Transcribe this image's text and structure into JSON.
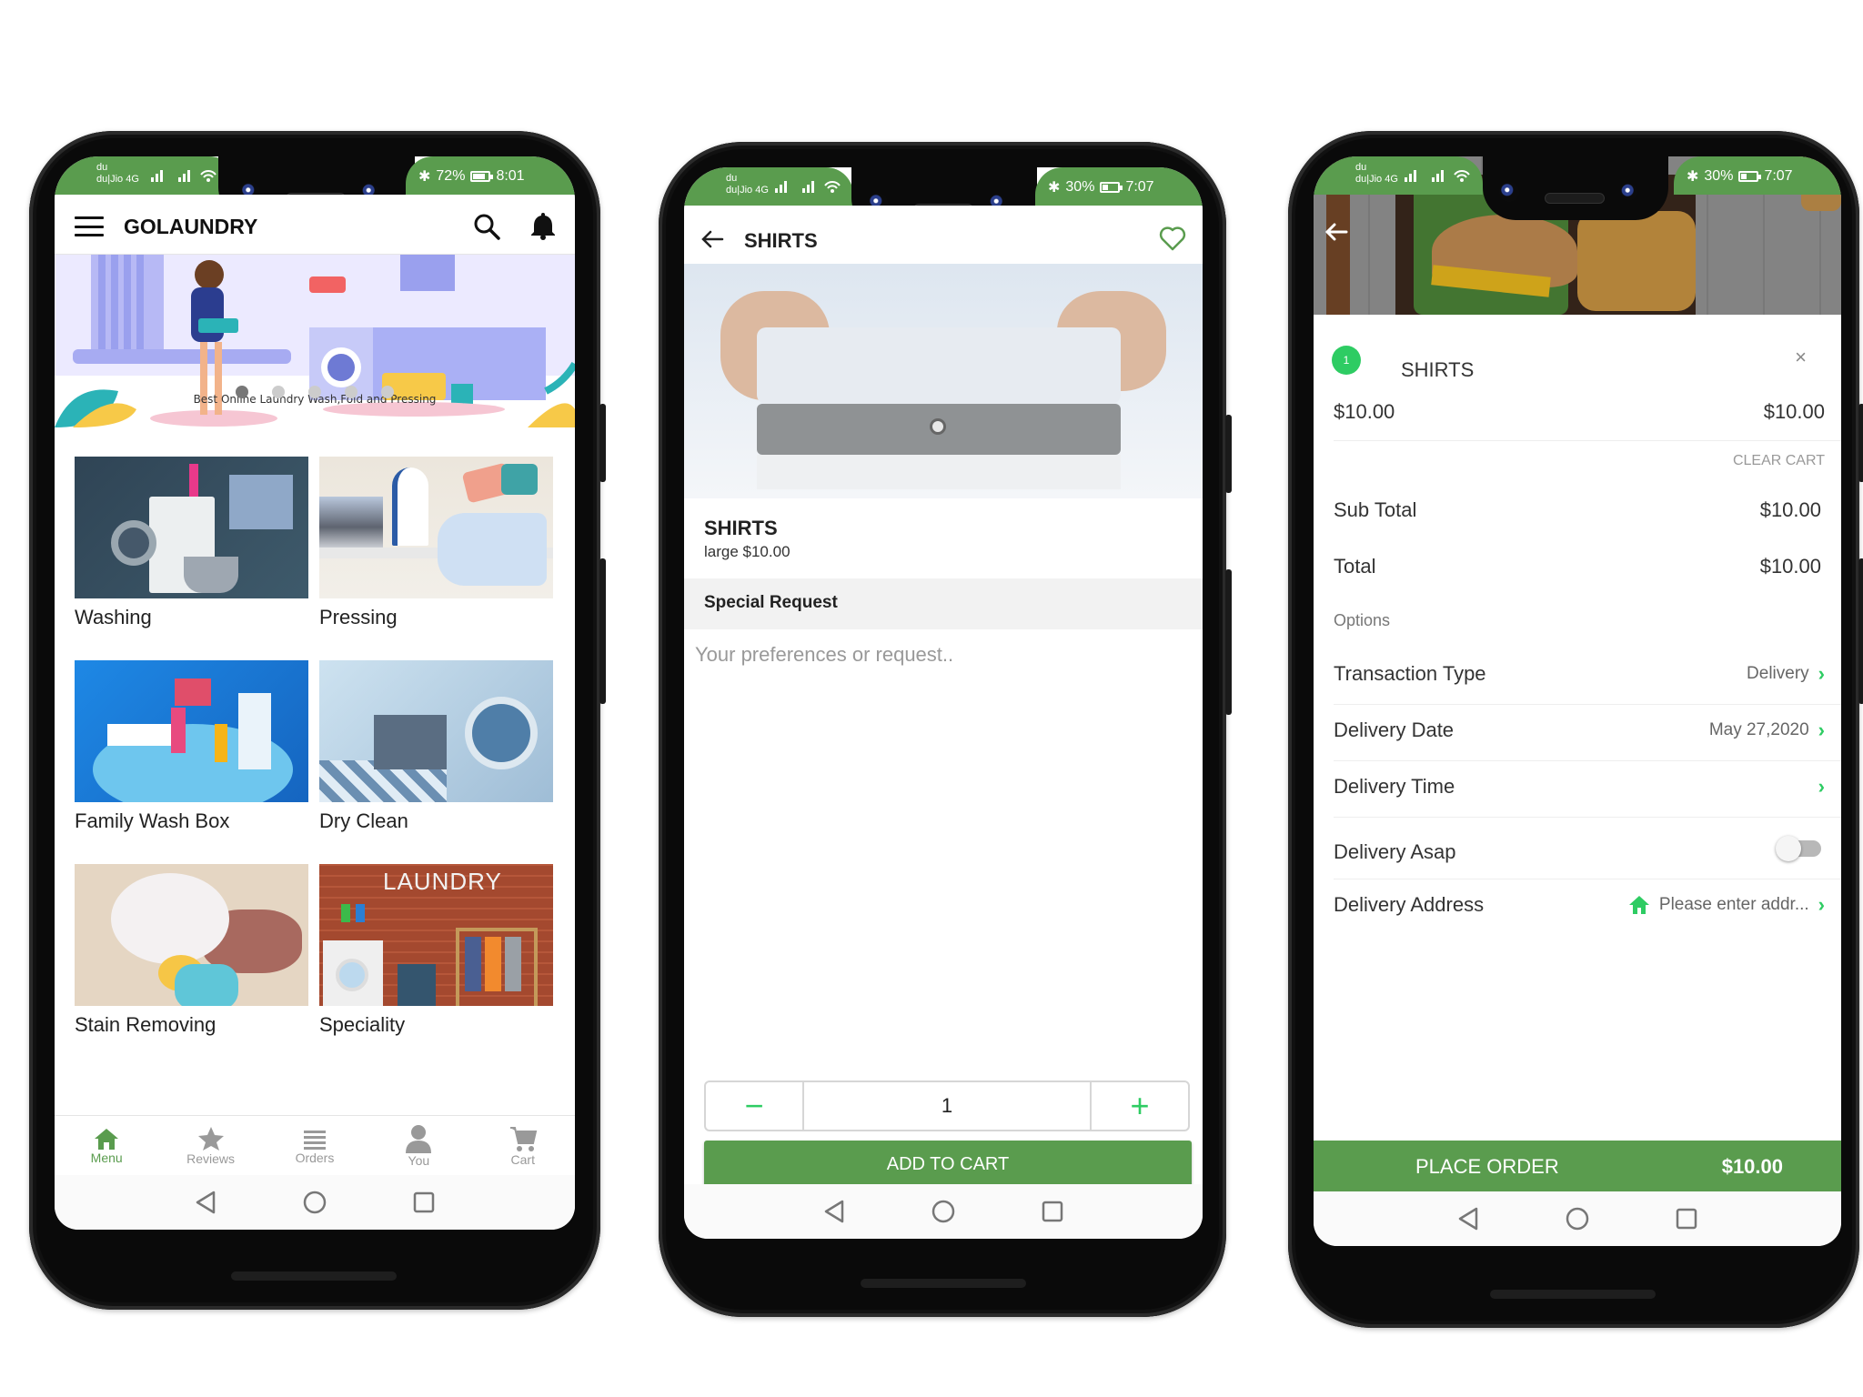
{
  "phones": {
    "home": {
      "status_bar": {
        "carrier_top": "du",
        "carrier_bottom": "du|Jio 4G",
        "net1": "4G",
        "net2": "3G R",
        "battery_text": "72%",
        "battery_level": 0.72,
        "time": "8:01"
      },
      "header": {
        "title": "GOLAUNDRY",
        "menu_icon": "hamburger-icon",
        "search_icon": "search-icon",
        "notification_icon": "bell-icon"
      },
      "banner": {
        "caption": "Best Online Laundry Wash,Fold and Pressing",
        "slide_count": 5,
        "active_slide": 1
      },
      "services": [
        {
          "label": "Washing"
        },
        {
          "label": "Pressing"
        },
        {
          "label": "Family Wash Box"
        },
        {
          "label": "Dry Clean"
        },
        {
          "label": "Stain Removing"
        },
        {
          "label": "Speciality"
        }
      ],
      "speciality_image_text": "LAUNDRY",
      "tabs": [
        {
          "label": "Menu",
          "icon": "home-icon",
          "active": true
        },
        {
          "label": "Reviews",
          "icon": "star-icon",
          "active": false
        },
        {
          "label": "Orders",
          "icon": "list-icon",
          "active": false
        },
        {
          "label": "You",
          "icon": "person-icon",
          "active": false
        },
        {
          "label": "Cart",
          "icon": "cart-icon",
          "active": false
        }
      ]
    },
    "product": {
      "status_bar": {
        "carrier_top": "du",
        "carrier_bottom": "du|Jio 4G",
        "net1": "3G",
        "net2": "3G R",
        "battery_text": "30%",
        "battery_level": 0.3,
        "time": "7:07"
      },
      "header": {
        "title": "SHIRTS",
        "back_icon": "arrow-left-icon",
        "favorite_icon": "heart-icon"
      },
      "product_name": "SHIRTS",
      "product_variant": "large $10.00",
      "special_request_label": "Special Request",
      "special_request_placeholder": "Your preferences or request..",
      "special_request_value": "",
      "quantity": "1",
      "decrement_symbol": "−",
      "increment_symbol": "+",
      "add_to_cart_label": "ADD TO CART"
    },
    "cart": {
      "status_bar": {
        "carrier_top": "du",
        "carrier_bottom": "du|Jio 4G",
        "net1": "3G",
        "net2": "3G R",
        "battery_text": "30%",
        "battery_level": 0.3,
        "time": "7:07"
      },
      "item": {
        "quantity_badge": "1",
        "name": "SHIRTS",
        "unit_price": "$10.00",
        "line_total": "$10.00",
        "remove_symbol": "×"
      },
      "clear_cart_label": "CLEAR CART",
      "sub_total_label": "Sub Total",
      "sub_total_value": "$10.00",
      "total_label": "Total",
      "total_value": "$10.00",
      "options_label": "Options",
      "options": {
        "transaction_type": {
          "label": "Transaction Type",
          "value": "Delivery"
        },
        "delivery_date": {
          "label": "Delivery Date",
          "value": "May 27,2020"
        },
        "delivery_time": {
          "label": "Delivery Time",
          "value": ""
        },
        "delivery_asap": {
          "label": "Delivery Asap",
          "enabled": false
        },
        "delivery_address": {
          "label": "Delivery Address",
          "value": "Please enter addr..."
        }
      },
      "place_order_label": "PLACE ORDER",
      "place_order_amount": "$10.00"
    }
  },
  "colors": {
    "brand_green": "#5a9c4e",
    "accent_green": "#2ecc63",
    "inactive_gray": "#999999"
  }
}
